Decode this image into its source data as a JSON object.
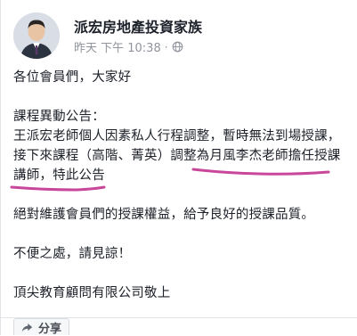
{
  "post": {
    "author": "派宏房地產投資家族",
    "timestamp": "昨天 下午 10:38",
    "meta_separator": "·",
    "audience_icon": "globe-icon",
    "lines": [
      "各位會員們，大家好",
      "",
      "課程異動公告：",
      "王派宏老師個人因素私人行程調整，暫時無法到場授課，",
      "接下來課程（高階、菁英）調整為月風李杰老師擔任授課",
      "講師，特此公告",
      "",
      "絕對維護會員們的授課權益，給予良好的授課品質。",
      "",
      "不便之處，請見諒！",
      "",
      "頂尖教育顧問有限公司敬上"
    ],
    "highlight_color": "#c8479b"
  },
  "actions": {
    "share_label": "分享",
    "share_icon": "share-icon"
  }
}
